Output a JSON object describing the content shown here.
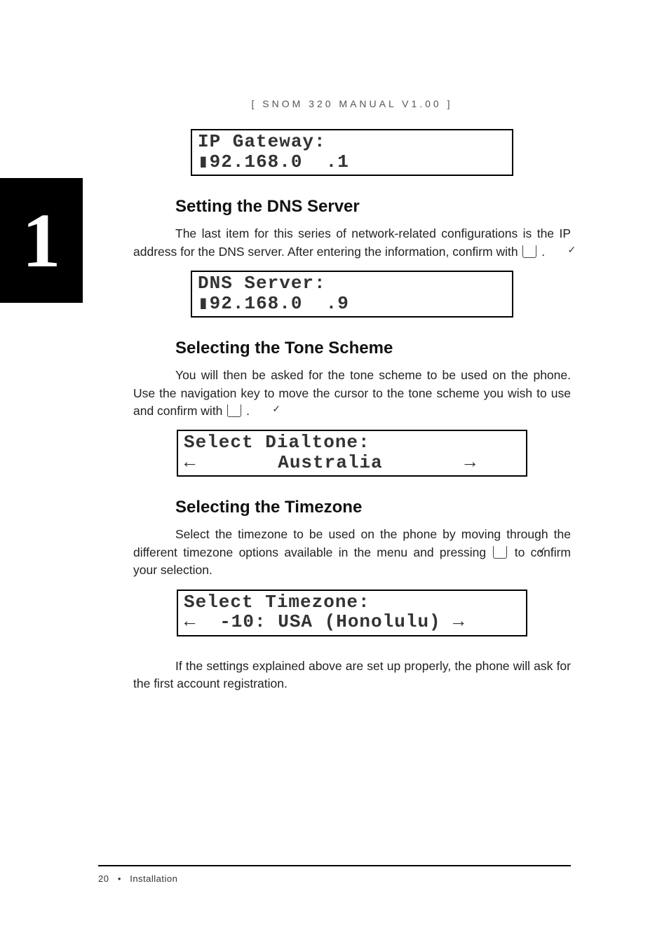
{
  "header": {
    "product": "SNOM",
    "model": "320",
    "word_manual": "MANUAL",
    "version": "V1.00"
  },
  "chapter": {
    "number": "1"
  },
  "lcd_ip_gateway": {
    "line1": "IP Gateway:",
    "line2": "▮92.168.0  .1"
  },
  "section_dns": {
    "title": "Setting the DNS Server",
    "para_a": "The last item for this series of network-related configurations is the IP address for the DNS server.  After entering the information, confirm with ",
    "para_b": "  ."
  },
  "lcd_dns": {
    "line1": "DNS Server:",
    "line2": "▮92.168.0  .9"
  },
  "section_tone": {
    "title": "Selecting the Tone Scheme",
    "para_a": "You will then be asked for the tone scheme to be used on the phone.  Use the navigation key to move the cursor to the tone scheme you wish to use and confirm with ",
    "para_b": " ."
  },
  "lcd_dialtone": {
    "line1": "Select Dialtone:",
    "line2_left": "←",
    "line2_mid": "       Australia       ",
    "line2_right": "→"
  },
  "section_tz": {
    "title": "Selecting the Timezone",
    "para_a": "Select the timezone to be used on the phone by moving through the different timezone options available in the menu and pressing ",
    "para_b": " to confirm your selection."
  },
  "lcd_tz": {
    "line1": "Select Timezone:",
    "line2_left": "←",
    "line2_mid": "  -10: USA (Honolulu) ",
    "line2_right": "→"
  },
  "closing": {
    "para": "If the settings explained above are set up properly, the phone will ask for the first account registration."
  },
  "footer": {
    "page_no": "20",
    "bullet": "•",
    "section": "Installation"
  }
}
